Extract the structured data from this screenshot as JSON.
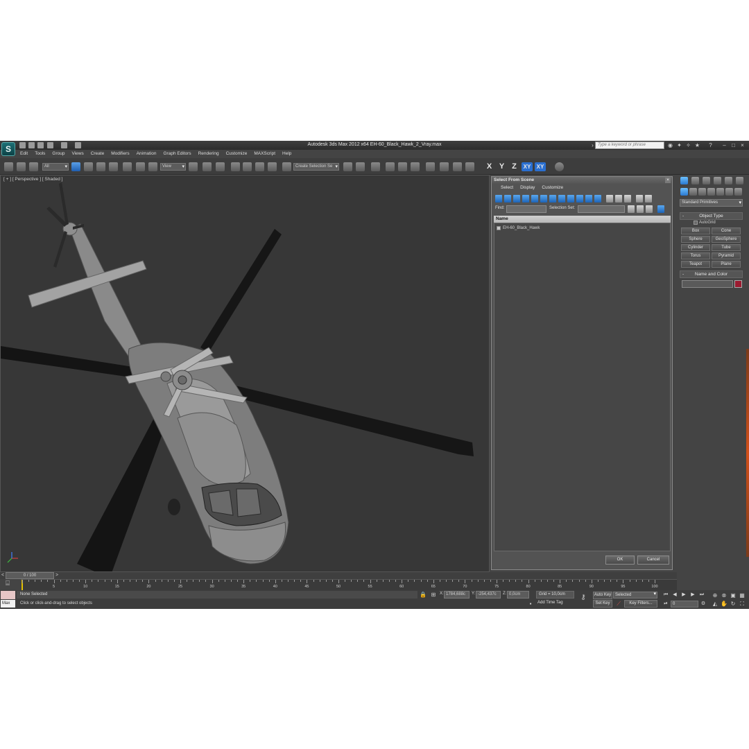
{
  "window": {
    "title": "Autodesk 3ds Max  2012 x64     EH-60_Black_Hawk_2_Vray.max",
    "search_placeholder": "Type a keyword or phrase"
  },
  "menu": [
    "Edit",
    "Tools",
    "Group",
    "Views",
    "Create",
    "Modifiers",
    "Animation",
    "Graph Editors",
    "Rendering",
    "Customize",
    "MAXScript",
    "Help"
  ],
  "toolbar": {
    "filter_dropdown": "All",
    "coord_dropdown": "View",
    "selection_set": "Create Selection Se",
    "axis_x": "X",
    "axis_y": "Y",
    "axis_z": "Z",
    "axis_xy": "XY",
    "axis_xy2": "XY"
  },
  "viewport": {
    "label": "[ + ] [ Perspective ] [ Shaded ]"
  },
  "dialog": {
    "title": "Select From Scene",
    "menus": [
      "Select",
      "Display",
      "Customize"
    ],
    "find_label": "Find:",
    "selection_set_label": "Selection Set:",
    "column_header": "Name",
    "items": [
      "EH-60_Black_Hawk"
    ],
    "ok_label": "OK",
    "cancel_label": "Cancel"
  },
  "command_panel": {
    "category": "Standard Primitives",
    "object_type_title": "Object Type",
    "autogrid_label": "AutoGrid",
    "primitives": [
      "Box",
      "Cone",
      "Sphere",
      "GeoSphere",
      "Cylinder",
      "Tube",
      "Torus",
      "Pyramid",
      "Teapot",
      "Plane"
    ],
    "name_color_title": "Name and Color",
    "color": "#9b1b30"
  },
  "timeline": {
    "position": "0 / 100",
    "current_frame": 0,
    "total_frames": 100,
    "tick_labels": [
      "0",
      "5",
      "10",
      "15",
      "20",
      "25",
      "30",
      "35",
      "40",
      "45",
      "50",
      "55",
      "60",
      "65",
      "70",
      "75",
      "80",
      "85",
      "90",
      "95",
      "100"
    ]
  },
  "status": {
    "selection": "None Selected",
    "prompt": "Click or click-and-drag to select objects",
    "maxscript": "Max",
    "x_label": "X:",
    "x_value": "1784,688c",
    "y_label": "Y:",
    "y_value": "-254,437c",
    "z_label": "Z:",
    "z_value": "0,0cm",
    "grid": "Grid = 10,0cm",
    "add_time_tag": "Add Time Tag",
    "auto_key": "Auto Key",
    "set_key": "Set Key",
    "key_mode": "Selected",
    "key_filters": "Key Filters...",
    "frame": "0"
  }
}
